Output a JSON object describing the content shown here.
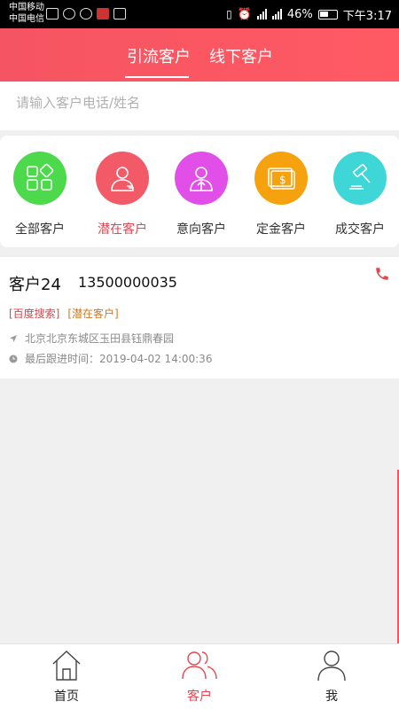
{
  "status_bar": {
    "carrier1": "中国移动",
    "carrier2": "中国电信",
    "battery": "46%",
    "time": "下午3:17"
  },
  "header": {
    "tabs": [
      {
        "label": "引流客户",
        "active": true
      },
      {
        "label": "线下客户",
        "active": false
      }
    ],
    "accent_color": "#f55462"
  },
  "search": {
    "placeholder": "请输入客户电话/姓名",
    "value": ""
  },
  "categories": [
    {
      "label": "全部客户",
      "icon": "grid-icon",
      "color": "#4cd94c"
    },
    {
      "label": "潜在客户",
      "icon": "person-icon",
      "color": "#f25a68",
      "active": true
    },
    {
      "label": "意向客户",
      "icon": "person-arrow-icon",
      "color": "#e24fe8"
    },
    {
      "label": "定金客户",
      "icon": "money-card-icon",
      "color": "#f6a20f"
    },
    {
      "label": "成交客户",
      "icon": "gavel-icon",
      "color": "#3ed6d6"
    }
  ],
  "customer": {
    "name": "客户24",
    "phone": "13500000035",
    "tag_source": "[百度搜索]",
    "tag_status": "[潜在客户]",
    "address": "北京北京东城区玉田县钰鼎春园",
    "last_follow": "最后跟进时间：2019-04-02 14:00:36"
  },
  "bottom_nav": [
    {
      "label": "首页",
      "icon": "home-icon"
    },
    {
      "label": "客户",
      "icon": "customers-icon",
      "active": true
    },
    {
      "label": "我",
      "icon": "profile-icon"
    }
  ]
}
